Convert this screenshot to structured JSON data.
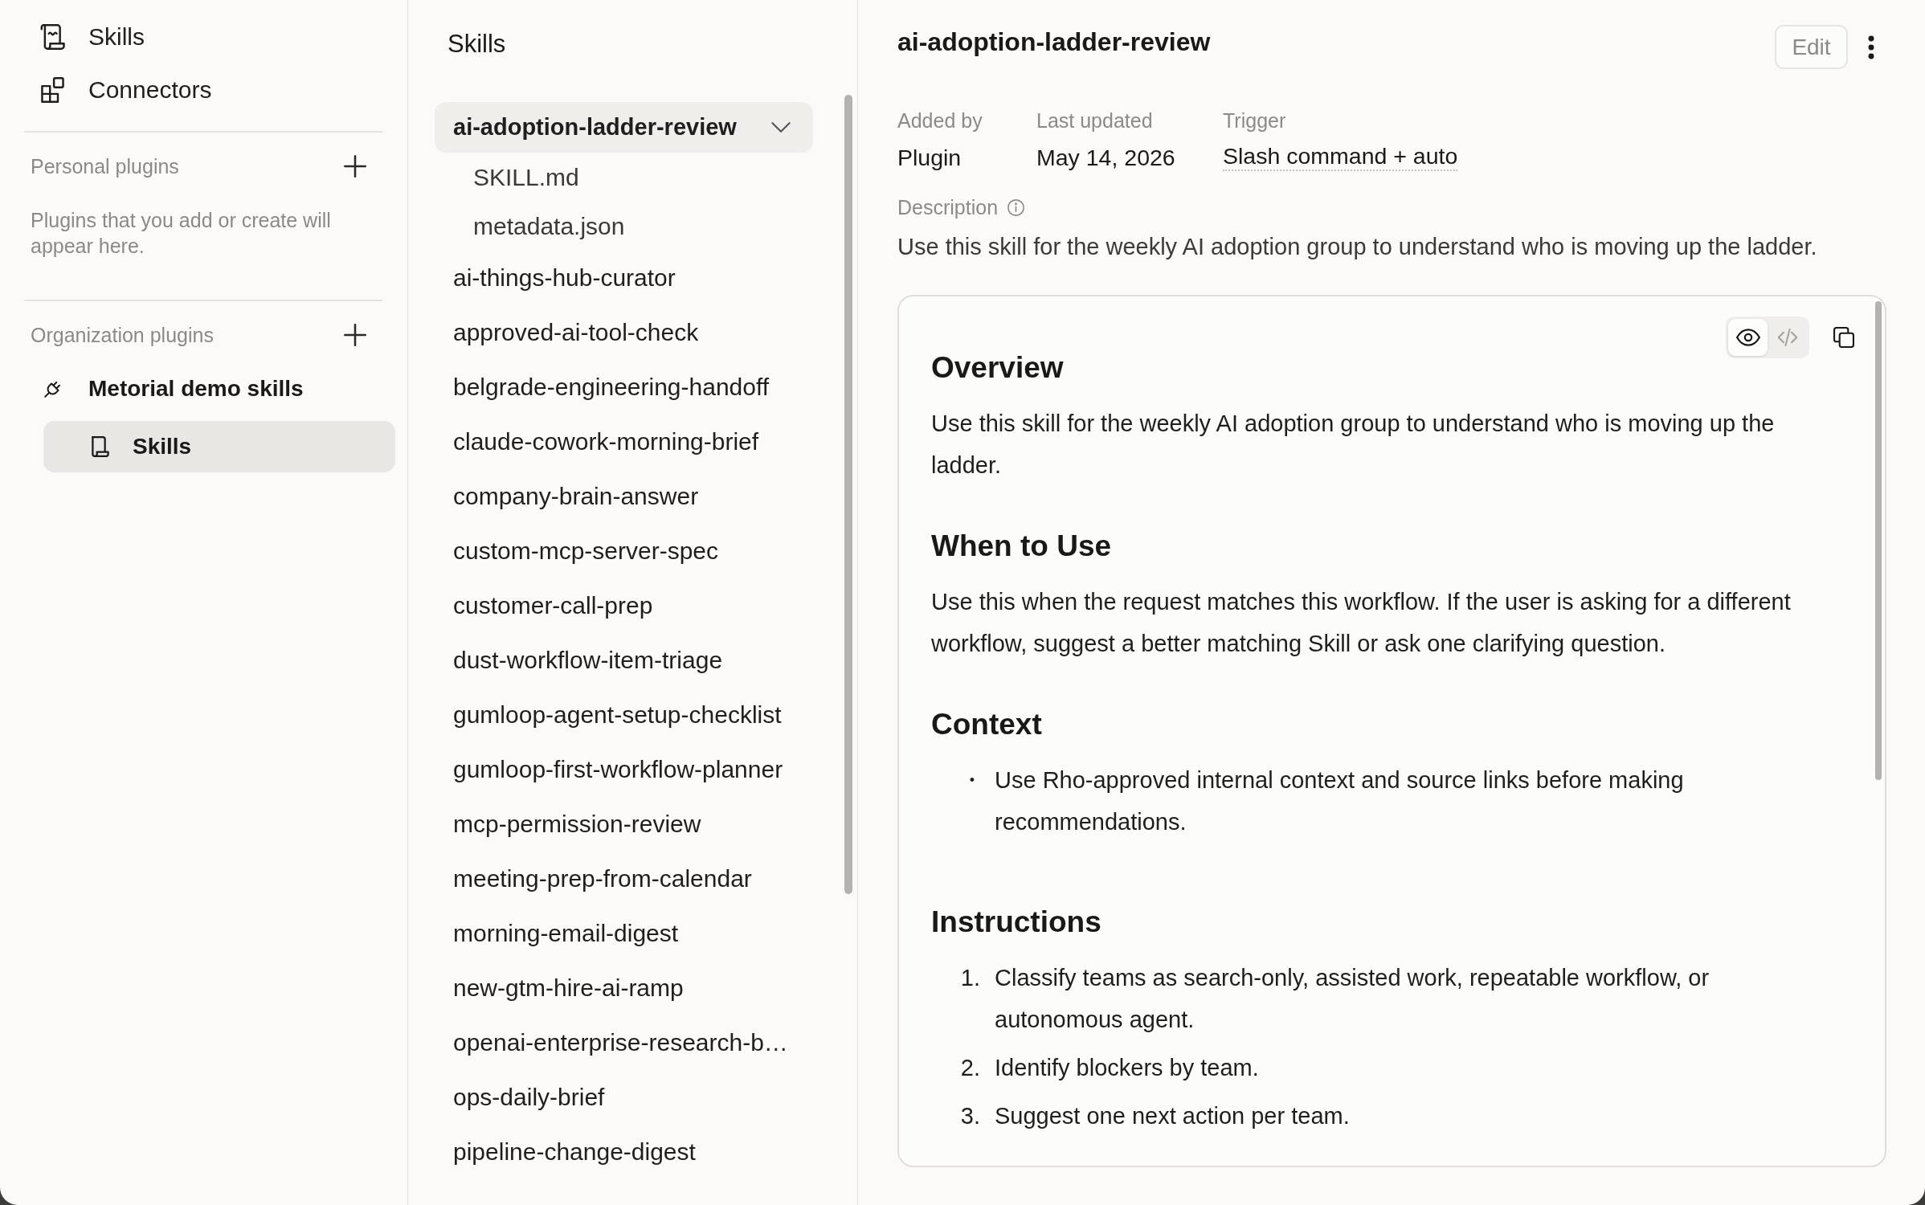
{
  "sidebar": {
    "nav": [
      {
        "kind": "skills",
        "label": "Skills",
        "selected": false
      },
      {
        "kind": "connectors",
        "label": "Connectors",
        "selected": false
      }
    ],
    "sections": [
      {
        "title": "Personal plugins",
        "empty_text": "Plugins that you add or create will appear here."
      },
      {
        "title": "Organization plugins",
        "plugins": [
          {
            "name": "Metorial demo skills",
            "children": [
              {
                "label": "Skills",
                "selected": true
              }
            ]
          }
        ]
      }
    ]
  },
  "skills_panel": {
    "title": "Skills",
    "items": [
      {
        "name": "ai-adoption-ladder-review",
        "selected": true,
        "expanded": true,
        "children": [
          {
            "name": "SKILL.md",
            "selected": false
          },
          {
            "name": "metadata.json",
            "selected": false
          }
        ]
      },
      {
        "name": "ai-things-hub-curator",
        "selected": false,
        "expanded": false
      },
      {
        "name": "approved-ai-tool-check",
        "selected": false,
        "expanded": false
      },
      {
        "name": "belgrade-engineering-handoff",
        "selected": false,
        "expanded": false
      },
      {
        "name": "claude-cowork-morning-brief",
        "selected": false,
        "expanded": false
      },
      {
        "name": "company-brain-answer",
        "selected": false,
        "expanded": false
      },
      {
        "name": "custom-mcp-server-spec",
        "selected": false,
        "expanded": false
      },
      {
        "name": "customer-call-prep",
        "selected": false,
        "expanded": false
      },
      {
        "name": "dust-workflow-item-triage",
        "selected": false,
        "expanded": false
      },
      {
        "name": "gumloop-agent-setup-checklist",
        "selected": false,
        "expanded": false
      },
      {
        "name": "gumloop-first-workflow-planner",
        "selected": false,
        "expanded": false
      },
      {
        "name": "mcp-permission-review",
        "selected": false,
        "expanded": false
      },
      {
        "name": "meeting-prep-from-calendar",
        "selected": false,
        "expanded": false
      },
      {
        "name": "morning-email-digest",
        "selected": false,
        "expanded": false
      },
      {
        "name": "new-gtm-hire-ai-ramp",
        "selected": false,
        "expanded": false
      },
      {
        "name": "openai-enterprise-research-b…",
        "selected": false,
        "expanded": false
      },
      {
        "name": "ops-daily-brief",
        "selected": false,
        "expanded": false
      },
      {
        "name": "pipeline-change-digest",
        "selected": false,
        "expanded": false
      }
    ]
  },
  "detail": {
    "title": "ai-adoption-ladder-review",
    "edit_label": "Edit",
    "meta": [
      {
        "kind": "plain",
        "label": "Added by",
        "value": "Plugin"
      },
      {
        "kind": "plain",
        "label": "Last updated",
        "value": "May 14, 2026"
      },
      {
        "kind": "tooltip",
        "label": "Trigger",
        "value": "Slash command + auto"
      }
    ],
    "description_label": "Description",
    "description": "Use this skill for the weekly AI adoption group to understand who is moving up the ladder.",
    "document": {
      "view_modes": [
        {
          "kind": "preview",
          "selected": true
        },
        {
          "kind": "code",
          "selected": false
        }
      ],
      "sections": [
        {
          "heading": "Overview",
          "blocks": [
            {
              "kind": "paragraph",
              "text": "Use this skill for the weekly AI adoption group to understand who is moving up the ladder."
            }
          ]
        },
        {
          "heading": "When to Use",
          "blocks": [
            {
              "kind": "paragraph",
              "text": "Use this when the request matches this workflow. If the user is asking for a different workflow, suggest a better matching Skill or ask one clarifying question."
            }
          ]
        },
        {
          "heading": "Context",
          "blocks": [
            {
              "kind": "bullets",
              "items": [
                {
                  "marker": "•",
                  "text": "Use Rho-approved internal context and source links before making recommendations."
                }
              ]
            }
          ]
        },
        {
          "heading": "Instructions",
          "blocks": [
            {
              "kind": "numbered",
              "items": [
                {
                  "marker": "1.",
                  "text": "Classify teams as search-only, assisted work, repeatable workflow, or autonomous agent."
                },
                {
                  "marker": "2.",
                  "text": "Identify blockers by team."
                },
                {
                  "marker": "3.",
                  "text": "Suggest one next action per team."
                }
              ]
            }
          ]
        }
      ]
    }
  }
}
